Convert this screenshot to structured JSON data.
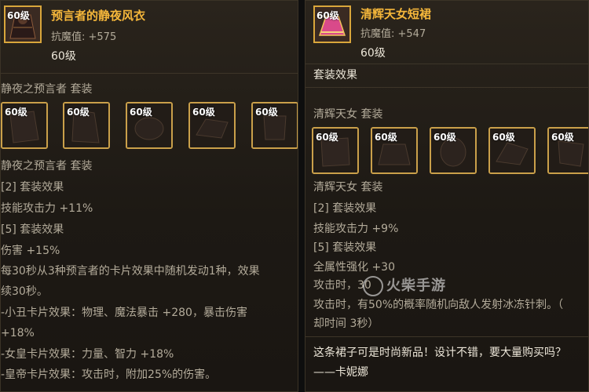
{
  "left": {
    "item_level": "60级",
    "item_name": "预言者的静夜风衣",
    "stat_line": "抗魔值: +575",
    "level_line": "60级",
    "set_title": "静夜之预言者  套装",
    "slot_level": "60级",
    "set_title_2": "静夜之预言者  套装",
    "bonus2_label": "[2] 套装效果",
    "bonus2_value": "技能攻击力 +11%",
    "bonus5_label": "[5] 套装效果",
    "bonus5_value": "伤害 +15%",
    "desc_1": "每30秒从3种预言者的卡片效果中随机发动1种，效果",
    "desc_2": "续30秒。",
    "card_1": "-小丑卡片效果：物理、魔法暴击 +280，暴击伤害",
    "card_1b": "+18%",
    "card_2": "-女皇卡片效果：力量、智力 +18%",
    "card_3": "-皇帝卡片效果：攻击时，附加25%的伤害。"
  },
  "right": {
    "item_level": "60级",
    "item_name": "清辉天女短裙",
    "stat_line": "抗魔值: +547",
    "level_line": "60级",
    "set_effect_header": "套装效果",
    "set_title": "清辉天女  套装",
    "slot_level": "60级",
    "set_title_2": "清辉天女  套装",
    "bonus2_label": "[2] 套装效果",
    "bonus2_value": "技能攻击力 +9%",
    "bonus5_label": "[5] 套装效果",
    "bonus5_value": "全属性强化 +30",
    "attack_1": "攻击时，30",
    "attack_2": "攻击时，有50%的概率随机向敌人发射冰冻针刺。（",
    "attack_3": "却时间 3秒）",
    "quote": "这条裙子可是时尚新品！设计不错，要大量购买吗？",
    "quote_author": "——卡妮娜"
  },
  "watermark": "火柴手游",
  "colors": {
    "title": "#f5b73b",
    "slot_border": "#caa04a",
    "panel_bg": "#1d1914"
  }
}
